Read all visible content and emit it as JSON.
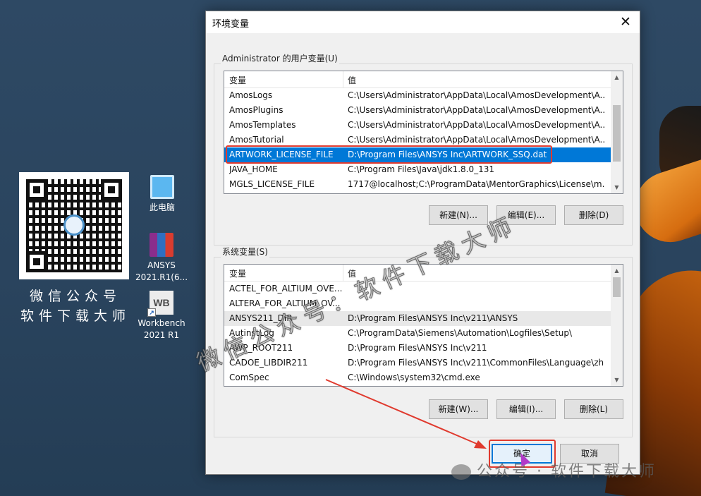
{
  "desktop": {
    "qr_caption_line1": "微信公众号",
    "qr_caption_line2": "软件下载大师",
    "icons": [
      {
        "name": "pc",
        "label": "此电脑"
      },
      {
        "name": "ansys",
        "label": "ANSYS 2021.R1(6..."
      },
      {
        "name": "workbench",
        "label": "Workbench 2021 R1",
        "glyph_text": "WB"
      }
    ]
  },
  "dialog": {
    "title": "环境变量",
    "close_glyph": "✕",
    "user_section": {
      "label": "Administrator 的用户变量(U)",
      "columns": [
        "变量",
        "值"
      ],
      "rows": [
        {
          "name": "AmosLogs",
          "value": "C:\\Users\\Administrator\\AppData\\Local\\AmosDevelopment\\A..."
        },
        {
          "name": "AmosPlugins",
          "value": "C:\\Users\\Administrator\\AppData\\Local\\AmosDevelopment\\A..."
        },
        {
          "name": "AmosTemplates",
          "value": "C:\\Users\\Administrator\\AppData\\Local\\AmosDevelopment\\A..."
        },
        {
          "name": "AmosTutorial",
          "value": "C:\\Users\\Administrator\\AppData\\Local\\AmosDevelopment\\A..."
        },
        {
          "name": "ARTWORK_LICENSE_FILE",
          "value": "D:\\Program Files\\ANSYS Inc\\ARTWORK_SSQ.dat",
          "selected": true
        },
        {
          "name": "JAVA_HOME",
          "value": "C:\\Program Files\\Java\\jdk1.8.0_131"
        },
        {
          "name": "MGLS_LICENSE_FILE",
          "value": "1717@localhost;C:\\ProgramData\\MentorGraphics\\License\\m..."
        }
      ],
      "buttons": {
        "new": "新建(N)...",
        "edit": "编辑(E)...",
        "delete": "删除(D)"
      }
    },
    "system_section": {
      "label": "系统变量(S)",
      "columns": [
        "变量",
        "值"
      ],
      "rows": [
        {
          "name": "ACTEL_FOR_ALTIUM_OVE...",
          "value": ""
        },
        {
          "name": "ALTERA_FOR_ALTIUM_OV...",
          "value": ""
        },
        {
          "name": "ANSYS211_DIR",
          "value": "D:\\Program Files\\ANSYS Inc\\v211\\ANSYS",
          "highlight": true
        },
        {
          "name": "AutinstLog",
          "value": "C:\\ProgramData\\Siemens\\Automation\\Logfiles\\Setup\\"
        },
        {
          "name": "AWP_ROOT211",
          "value": "D:\\Program Files\\ANSYS Inc\\v211"
        },
        {
          "name": "CADOE_LIBDIR211",
          "value": "D:\\Program Files\\ANSYS Inc\\v211\\CommonFiles\\Language\\zh"
        },
        {
          "name": "ComSpec",
          "value": "C:\\Windows\\system32\\cmd.exe"
        }
      ],
      "buttons": {
        "new": "新建(W)...",
        "edit": "编辑(I)...",
        "delete": "删除(L)"
      }
    },
    "footer_buttons": {
      "ok": "确定",
      "cancel": "取消"
    }
  },
  "overlay": {
    "watermark_text": "微信公众号：软件下载大师",
    "wechat_mark": "公众号 · 软件下载大师",
    "annotation_color": "#e03a2e",
    "selection_color": "#0078d7"
  }
}
